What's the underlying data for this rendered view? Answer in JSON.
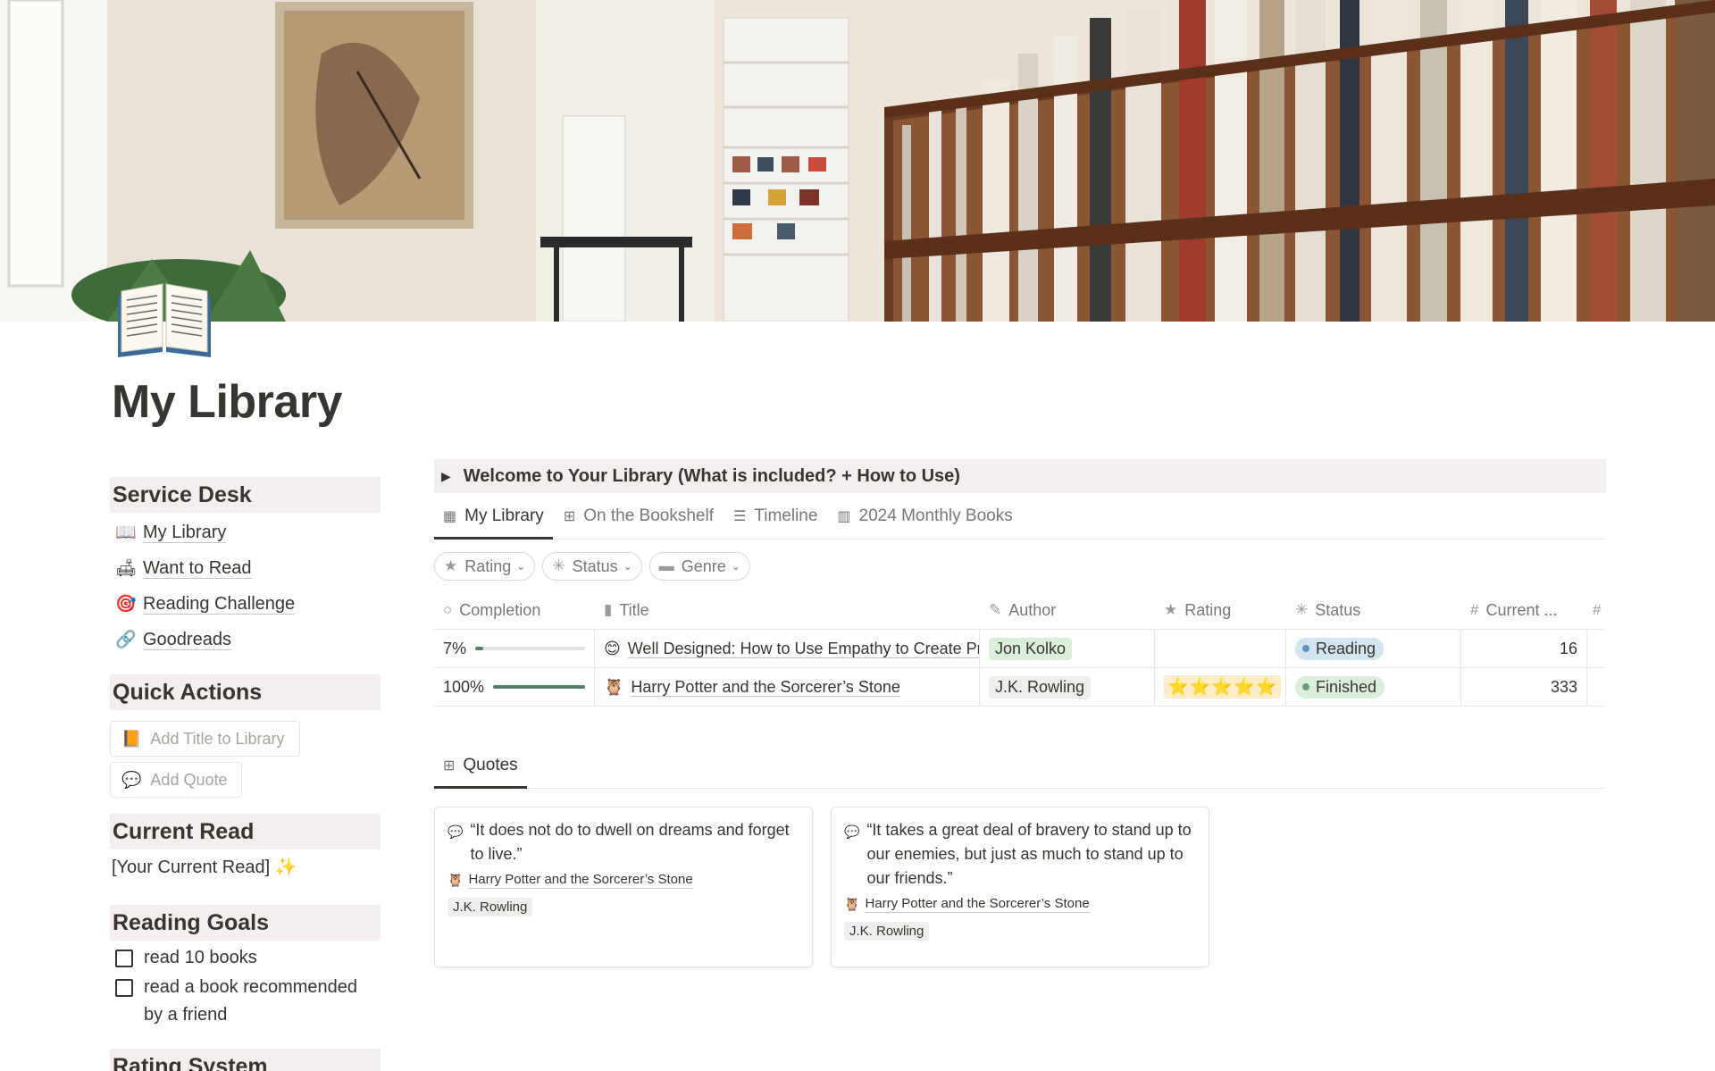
{
  "page": {
    "title": "My Library",
    "cover_icon": "open-book-emoji"
  },
  "sidebar": {
    "service_desk": {
      "heading": "Service Desk",
      "links": [
        {
          "emoji": "📖",
          "label": "My Library"
        },
        {
          "emoji": "🛋",
          "label": "Want to Read"
        },
        {
          "emoji": "🎯",
          "label": "Reading Challenge"
        },
        {
          "emoji": "🔗",
          "label": "Goodreads"
        }
      ]
    },
    "quick_actions": {
      "heading": "Quick Actions",
      "buttons": [
        {
          "emoji": "📙",
          "label": "Add Title to Library"
        },
        {
          "emoji": "💬",
          "label": "Add Quote"
        }
      ]
    },
    "current_read": {
      "heading": "Current Read",
      "text": "[Your Current Read] ✨"
    },
    "reading_goals": {
      "heading": "Reading Goals",
      "items": [
        {
          "label": "read 10 books",
          "checked": false
        },
        {
          "label": "read a book recommended by a friend",
          "checked": false
        }
      ]
    },
    "next_heading": "Rating System"
  },
  "toggle": {
    "label": "Welcome to Your Library (What is included? + How to Use)"
  },
  "library_tabs": [
    {
      "label": "My Library",
      "icon": "table-icon",
      "active": true
    },
    {
      "label": "On the Bookshelf",
      "icon": "gallery-icon",
      "active": false
    },
    {
      "label": "Timeline",
      "icon": "timeline-icon",
      "active": false
    },
    {
      "label": "2024 Monthly Books",
      "icon": "board-icon",
      "active": false
    }
  ],
  "filters": [
    {
      "label": "Rating",
      "icon": "star-icon"
    },
    {
      "label": "Status",
      "icon": "status-icon"
    },
    {
      "label": "Genre",
      "icon": "genre-icon"
    }
  ],
  "table": {
    "columns": [
      "Completion",
      "Title",
      "Author",
      "Rating",
      "Status",
      "Current ..."
    ],
    "rows": [
      {
        "completion": "7%",
        "completion_value": 0.07,
        "emoji": "😊",
        "title": "Well Designed: How to Use Empathy to Create Products People Love",
        "author": "Jon Kolko",
        "author_color": "green",
        "rating": "",
        "status": "Reading",
        "status_color": "blue",
        "current": "16"
      },
      {
        "completion": "100%",
        "completion_value": 1.0,
        "emoji": "🦉",
        "title": "Harry Potter and the Sorcerer’s Stone",
        "author": "J.K. Rowling",
        "author_color": "gray",
        "rating": "⭐⭐⭐⭐⭐",
        "status": "Finished",
        "status_color": "green",
        "current": "333"
      }
    ]
  },
  "quotes_tab": {
    "label": "Quotes",
    "icon": "gallery-icon"
  },
  "quotes": [
    {
      "text": "“It does not do to dwell on dreams and forget to live.”",
      "book": "Harry Potter and the Sorcerer’s Stone",
      "author": "J.K. Rowling"
    },
    {
      "text": "“It takes a great deal of bravery to stand up to our enemies, but just as much to stand up to our friends.”",
      "book": "Harry Potter and the Sorcerer’s Stone",
      "author": "J.K. Rowling"
    }
  ]
}
